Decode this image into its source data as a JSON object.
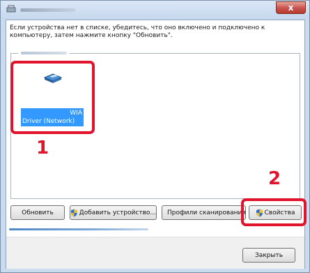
{
  "window": {
    "close_glyph": "x"
  },
  "instructions": "Если устройства нет в списке, убедитесь, что оно включено и подключено к компьютеру, затем нажмите кнопку \"Обновить\".",
  "device": {
    "label_line1": "WIA",
    "label_line2": "Driver (Network)"
  },
  "callouts": {
    "first": "1",
    "second": "2"
  },
  "buttons": {
    "refresh": "Обновить",
    "add_device": "Добавить устройство...",
    "scan_profiles": "Профили сканирования...",
    "properties": "Свойства",
    "close": "Закрыть"
  },
  "colors": {
    "highlight": "#e0142c",
    "selection": "#3399ff",
    "close_button": "#c75050"
  },
  "icons": [
    "app-icon",
    "scanner-icon",
    "shield-icon"
  ]
}
